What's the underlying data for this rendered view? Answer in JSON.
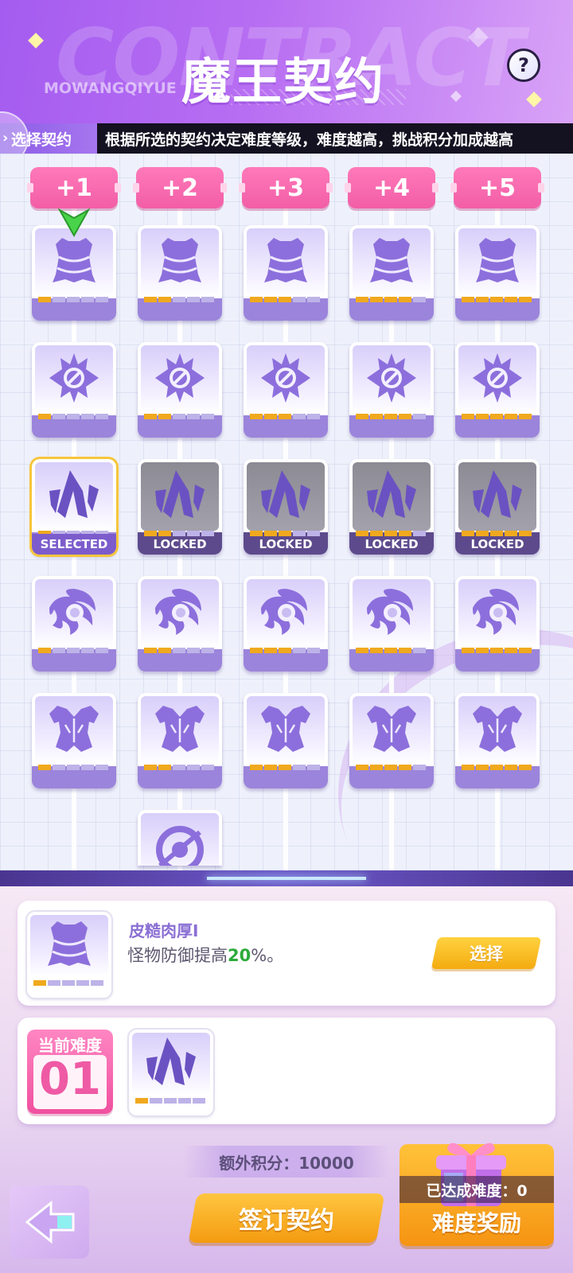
{
  "header": {
    "bg_word": "CONTRACT",
    "sub_word": "MOWANGQIYUE",
    "title": "魔王契约",
    "help_symbol": "?"
  },
  "info_bar": {
    "tag_label": "选择契约",
    "description": "根据所选的契约决定难度等级，难度越高，挑战积分加成越高"
  },
  "levels": [
    "+1",
    "+2",
    "+3",
    "+4",
    "+5"
  ],
  "grid": {
    "row_icons": [
      "armor-icon",
      "crosshair-icon",
      "crystal-icon",
      "vortex-icon",
      "torso-icon",
      "target-slash-icon"
    ],
    "status_selected": "SELECTED",
    "status_locked": "LOCKED"
  },
  "detail": {
    "name": "皮糙肉厚I",
    "desc_prefix": "怪物防御提高",
    "desc_value": "20",
    "desc_suffix": "%。",
    "select_label": "选择"
  },
  "difficulty": {
    "label": "当前难度",
    "value": "01"
  },
  "footer": {
    "extra_points": "额外积分：10000",
    "sign_label": "签订契约",
    "reward_status": "已达成难度：0",
    "reward_label": "难度奖励"
  },
  "colors": {
    "header_purple": "#a45cf0",
    "pill_pink": "#f25ea7",
    "pip_active": "#f0a91e",
    "pip_inactive": "#bdb3e8",
    "card_purple": "#9b84db",
    "button_orange": "#f49b10",
    "green_value": "#2cab3a"
  }
}
